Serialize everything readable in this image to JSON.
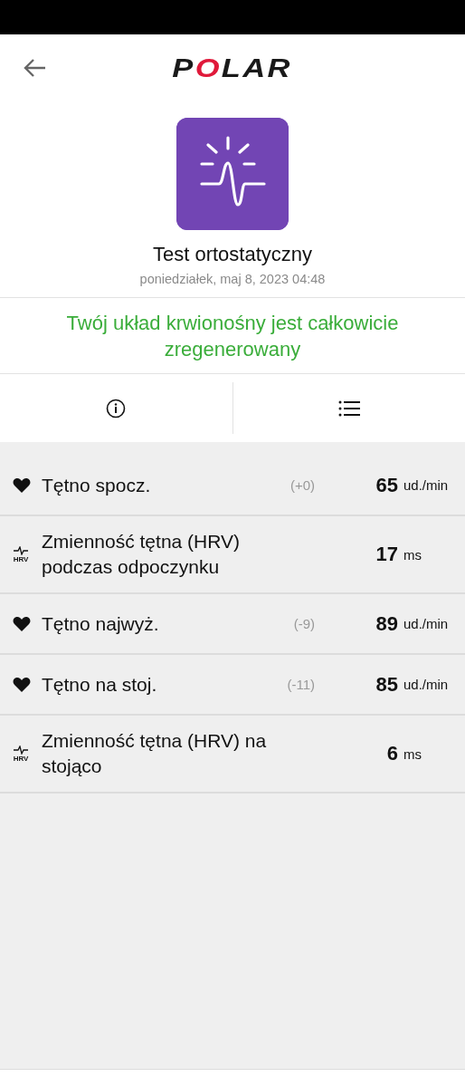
{
  "header": {
    "logo": "POLAR"
  },
  "test": {
    "title": "Test ortostatyczny",
    "date": "poniedziałek, maj 8, 2023 04:48"
  },
  "message": "Twój układ krwionośny jest całkowicie zregenerowany",
  "tabs": [
    {
      "kind": "info"
    },
    {
      "kind": "list"
    }
  ],
  "metrics": [
    {
      "kind": "heart",
      "label": "Tętno spocz.",
      "delta": "(+0)",
      "value": "65",
      "unit": "ud./min"
    },
    {
      "kind": "hrv",
      "icon_text": "HRV",
      "label": "Zmienność tętna (HRV) podczas odpoczynku",
      "value": "17",
      "unit": "ms"
    },
    {
      "kind": "heart",
      "label": "Tętno najwyż.",
      "delta": "(-9)",
      "value": "89",
      "unit": "ud./min"
    },
    {
      "kind": "heart",
      "label": "Tętno na stoj.",
      "delta": "(-11)",
      "value": "85",
      "unit": "ud./min"
    },
    {
      "kind": "hrv",
      "icon_text": "HRV",
      "label": "Zmienność tętna (HRV) na stojąco",
      "value": "6",
      "unit": "ms"
    }
  ]
}
